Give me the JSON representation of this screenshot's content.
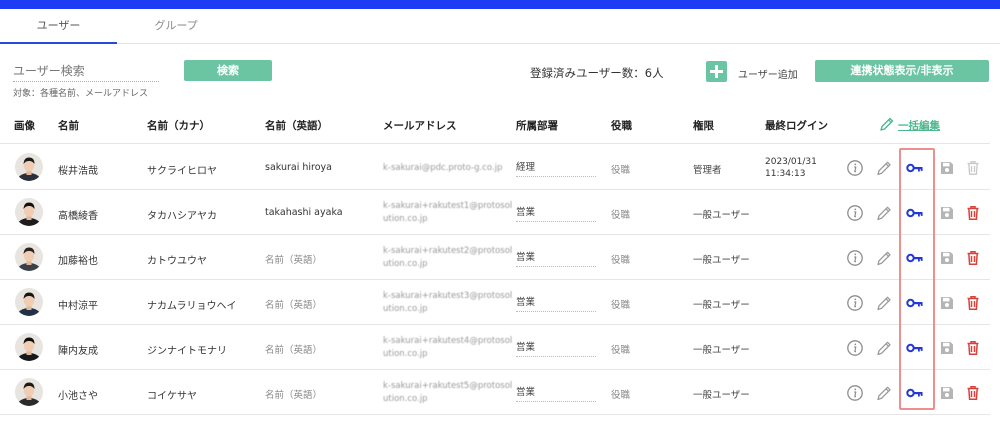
{
  "tabs": [
    {
      "label": "ユーザー",
      "active": true
    },
    {
      "label": "グループ",
      "active": false
    }
  ],
  "search": {
    "placeholder": "ユーザー検索",
    "hint": "対象：各種名前、メールアドレス",
    "button_label": "検索"
  },
  "user_count_text": "登録済みユーザー数：6人",
  "add_user_label": "ユーザー追加",
  "link_toggle_label": "連携状態表示/非表示",
  "bulk_edit_label": "一括編集",
  "columns": [
    "画像",
    "名前",
    "名前（カナ）",
    "名前（英語）",
    "メールアドレス",
    "所属部署",
    "役職",
    "権限",
    "最終ログイン"
  ],
  "users": [
    {
      "name": "桜井浩哉",
      "kana": "サクライヒロヤ",
      "english": "sakurai hiroya",
      "email_lines": [
        "k-sakurai@pdc.proto-g.co.jp"
      ],
      "dept": "経理",
      "role": "役職",
      "permission": "管理者",
      "last_login": "2023/01/31\n11:34:13"
    },
    {
      "name": "高橋綾香",
      "kana": "タカハシアヤカ",
      "english": "takahashi ayaka",
      "email_lines": [
        "k-sakurai+rakutest1@protosol",
        "ution.co.jp"
      ],
      "dept": "営業",
      "role": "役職",
      "permission": "一般ユーザー",
      "last_login": ""
    },
    {
      "name": "加藤裕也",
      "kana": "カトウユウヤ",
      "english": "名前（英語）",
      "email_lines": [
        "k-sakurai+rakutest2@protosol",
        "ution.co.jp"
      ],
      "dept": "営業",
      "role": "役職",
      "permission": "一般ユーザー",
      "last_login": ""
    },
    {
      "name": "中村涼平",
      "kana": "ナカムラリョウヘイ",
      "english": "名前（英語）",
      "email_lines": [
        "k-sakurai+rakutest3@protosol",
        "ution.co.jp"
      ],
      "dept": "営業",
      "role": "役職",
      "permission": "一般ユーザー",
      "last_login": ""
    },
    {
      "name": "陣内友成",
      "kana": "ジンナイトモナリ",
      "english": "名前（英語）",
      "email_lines": [
        "k-sakurai+rakutest4@protosol",
        "ution.co.jp"
      ],
      "dept": "営業",
      "role": "役職",
      "permission": "一般ユーザー",
      "last_login": ""
    },
    {
      "name": "小池さや",
      "kana": "コイケサヤ",
      "english": "名前（英語）",
      "email_lines": [
        "k-sakurai+rakutest5@protosol",
        "ution.co.jp"
      ],
      "dept": "営業",
      "role": "役職",
      "permission": "一般ユーザー",
      "last_login": ""
    }
  ],
  "row_icons": [
    "info-icon",
    "pencil-icon",
    "key-icon",
    "save-icon",
    "trash-icon"
  ],
  "colors": {
    "top_bar": "#1f3cf5",
    "accent_green": "#6cc5a2",
    "key_blue": "#2338d6",
    "delete_red": "#d9423b",
    "highlight_border": "#ee8f8f"
  }
}
